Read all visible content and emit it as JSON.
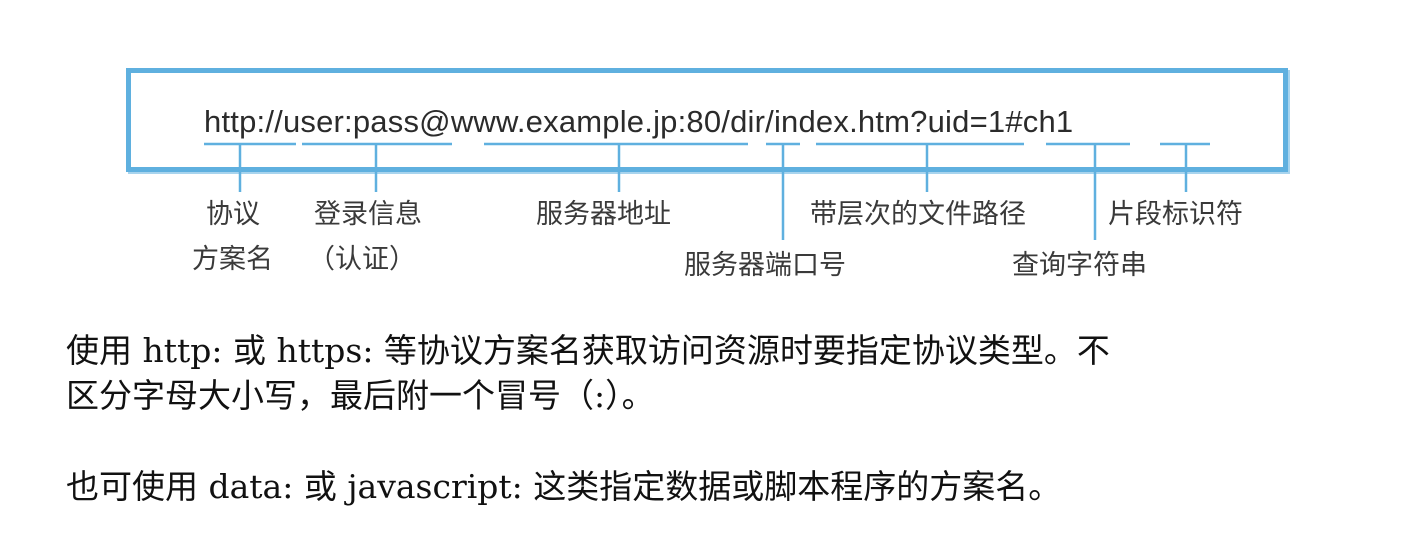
{
  "diagram": {
    "url": "http://user:pass@www.example.jp:80/dir/index.htm?uid=1#ch1",
    "labels": {
      "scheme_1": "协议",
      "scheme_2": "方案名",
      "credentials_1": "登录信息",
      "credentials_2": "（认证）",
      "server": "服务器地址",
      "port": "服务器端口号",
      "path": "带层次的文件路径",
      "query": "查询字符串",
      "fragment": "片段标识符"
    },
    "accent_color": "#5fb0df"
  },
  "text": {
    "line1": "使用 http: 或 https: 等协议方案名获取访问资源时要指定协议类型。不",
    "line2": "区分字母大小写，最后附一个冒号（:）。",
    "line3": "也可使用 data: 或 javascript: 这类指定数据或脚本程序的方案名。"
  }
}
